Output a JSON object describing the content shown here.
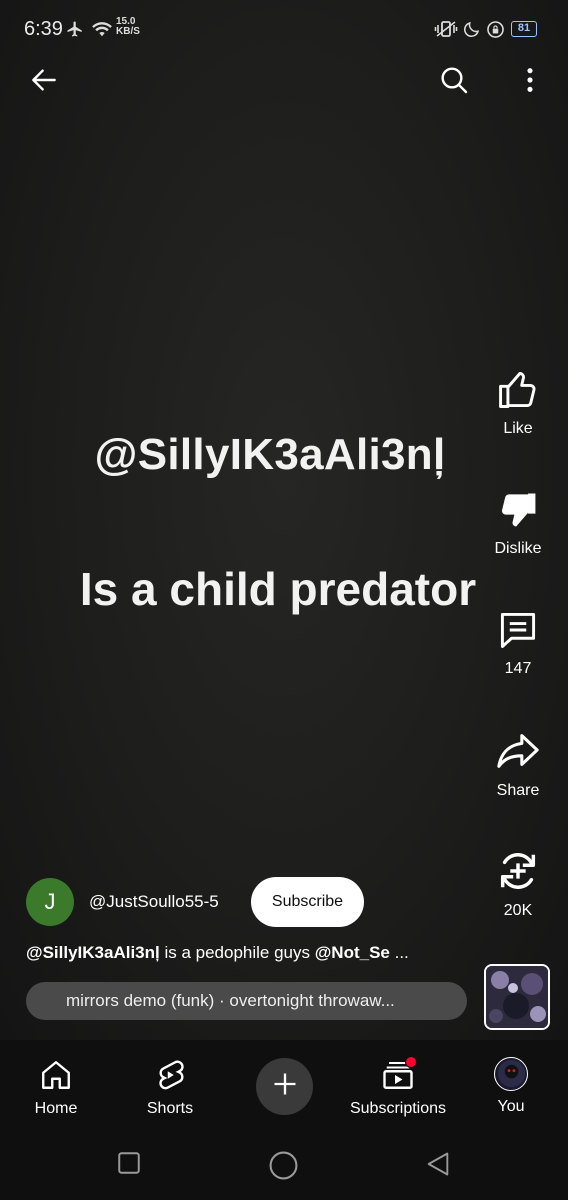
{
  "status_bar": {
    "time": "6:39",
    "net_speed_value": "15.0",
    "net_speed_unit": "KB/S",
    "battery": "81",
    "icons": [
      "airplane-icon",
      "wifi-icon",
      "vibrate-icon",
      "moon-icon",
      "lock-rotation-icon",
      "battery-icon"
    ]
  },
  "top_bar": {
    "icons": [
      "back-arrow-icon",
      "search-icon",
      "more-vert-icon"
    ]
  },
  "video_overlay": {
    "line1": "@SillyIK3aAli3nļ",
    "line2": "Is a child predator"
  },
  "actions": {
    "like_label": "Like",
    "dislike_label": "Dislike",
    "comments_count": "147",
    "share_label": "Share",
    "remix_count": "20K"
  },
  "channel": {
    "avatar_letter": "J",
    "avatar_color": "#3a7a2a",
    "name": "@JustSoullo55-5",
    "subscribe_label": "Subscribe"
  },
  "description": {
    "mention1": "@SillyIK3aAli3nļ",
    "text": " is a pedophile guys ",
    "mention2": "@Not_Se",
    "ellipsis": " ..."
  },
  "music": {
    "title": "mirrors demo (funk) · overtonight throwaw..."
  },
  "bottom_nav": {
    "home": "Home",
    "shorts": "Shorts",
    "subscriptions": "Subscriptions",
    "you": "You"
  },
  "colors": {
    "accent_red": "#ff0033",
    "background": "#0f0f0f"
  }
}
